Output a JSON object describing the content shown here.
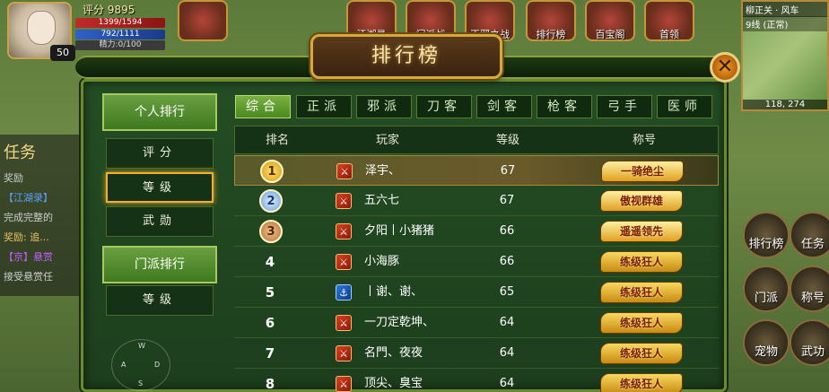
{
  "hud": {
    "player": {
      "score_label": "评分 9895",
      "level": "50",
      "hp": "1399/1594",
      "mp": "792/1111",
      "energy": "精力:0/100"
    },
    "top_icons": [
      "江湖录",
      "门派战",
      "正邪之战",
      "排行榜",
      "百宝阁",
      "首领"
    ],
    "minimap": {
      "place": "柳正关 · 风车",
      "line": "9线 (正常)",
      "coords": "118, 274"
    },
    "right_buttons": [
      "排行榜",
      "任务",
      "门派",
      "称号",
      "宠物",
      "武功"
    ],
    "quest": {
      "title": "任务",
      "lines": [
        "奖励",
        "【江湖录】",
        "完成完整的",
        "奖励: 追...",
        "【京】悬赏",
        "接受悬赏任"
      ]
    },
    "joystick": {
      "n": "W",
      "w": "A",
      "e": "D",
      "s": "S"
    }
  },
  "panel": {
    "title": "排行榜",
    "close_label": "✕",
    "nav": {
      "personal_header": "个人排行",
      "personal_items": [
        "评分",
        "等级",
        "武勋"
      ],
      "active_item": "等级",
      "sect_header": "门派排行",
      "sect_items": [
        "等级"
      ]
    },
    "tabs": [
      "综合",
      "正派",
      "邪派",
      "刀客",
      "剑客",
      "枪客",
      "弓手",
      "医师"
    ],
    "active_tab": "综合",
    "columns": [
      "排名",
      "玩家",
      "等级",
      "称号"
    ],
    "rows": [
      {
        "rank": "1",
        "faction": "red",
        "name": "泽宇、",
        "level": "67",
        "title": "一骑绝尘"
      },
      {
        "rank": "2",
        "faction": "red",
        "name": "五六七",
        "level": "67",
        "title": "傲视群雄"
      },
      {
        "rank": "3",
        "faction": "red",
        "name": "夕阳丨小猪猪",
        "level": "66",
        "title": "遥遥领先"
      },
      {
        "rank": "4",
        "faction": "red",
        "name": "小海豚",
        "level": "66",
        "title": "练级狂人"
      },
      {
        "rank": "5",
        "faction": "blue",
        "name": "丨谢、谢、",
        "level": "65",
        "title": "练级狂人"
      },
      {
        "rank": "6",
        "faction": "red",
        "name": "一刀定乾坤、",
        "level": "64",
        "title": "练级狂人"
      },
      {
        "rank": "7",
        "faction": "red",
        "name": "名門、夜夜",
        "level": "64",
        "title": "练级狂人"
      },
      {
        "rank": "8",
        "faction": "red",
        "name": "顶尖、臭宝",
        "level": "64",
        "title": "练级狂人"
      }
    ]
  }
}
